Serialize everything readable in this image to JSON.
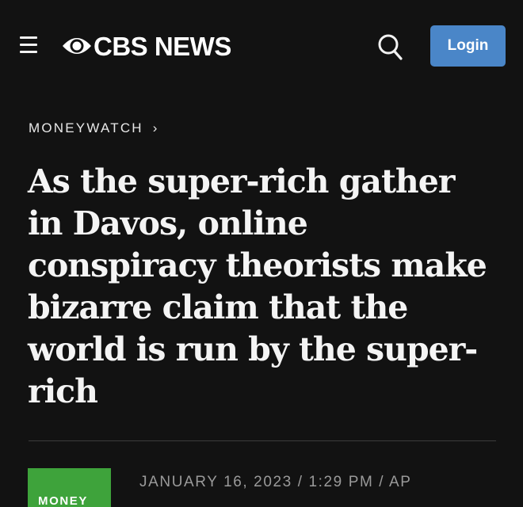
{
  "header": {
    "menu_icon": "hamburger-menu-icon",
    "logo_icon": "cbs-eye-icon",
    "logo_text": "CBS NEWS",
    "search_icon": "search-icon",
    "login_label": "Login",
    "login_color": "#4a86c8"
  },
  "breadcrumb": {
    "label": "MONEYWATCH",
    "chevron": "›"
  },
  "article": {
    "headline": "As the super-rich gather in Davos, online conspiracy theorists make bizarre claim that the world is run by the super-rich",
    "tag_label": "MONEY",
    "tag_color": "#3ea33b",
    "byline": "JANUARY 16, 2023 / 1:29 PM / AP"
  }
}
